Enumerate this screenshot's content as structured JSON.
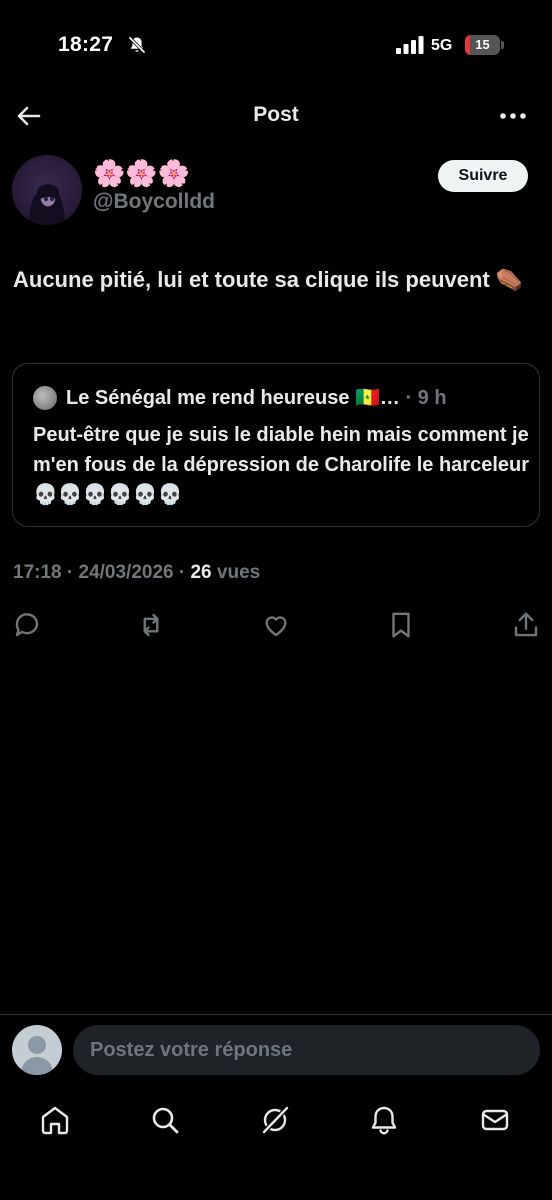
{
  "status_bar": {
    "time": "18:27",
    "network": "5G",
    "battery": "15",
    "battery_level": 0.15,
    "battery_color": "#e5393a"
  },
  "header": {
    "title": "Post",
    "back_icon": "arrow-left-icon",
    "more_icon": "more-horizontal-icon"
  },
  "post": {
    "display_name": "🌸🌸🌸",
    "handle": "@Boycolldd",
    "follow_label": "Suivre",
    "text": "Aucune pitié, lui et toute sa clique ils peuvent ⚰️",
    "quote": {
      "author": "Le Sénégal me rend heureuse 🇸🇳…",
      "time": " · 9 h",
      "text": "Peut-être que je suis le diable hein mais comment je m'en fous de la dépression de Charolife le harceleur 💀💀💀💀💀💀"
    },
    "meta": {
      "time": "17:18",
      "date": "24/03/2026",
      "views_count": "26",
      "views_label": "vues"
    },
    "actions": [
      "reply-icon",
      "repost-icon",
      "like-icon",
      "bookmark-icon",
      "share-icon"
    ]
  },
  "reply": {
    "placeholder": "Postez votre réponse"
  },
  "nav": [
    "home-icon",
    "search-icon",
    "grok-icon",
    "notifications-icon",
    "messages-icon"
  ],
  "colors": {
    "background": "#000000",
    "text": "#e7e9ea",
    "muted": "#71767b",
    "border": "#2f3336"
  }
}
